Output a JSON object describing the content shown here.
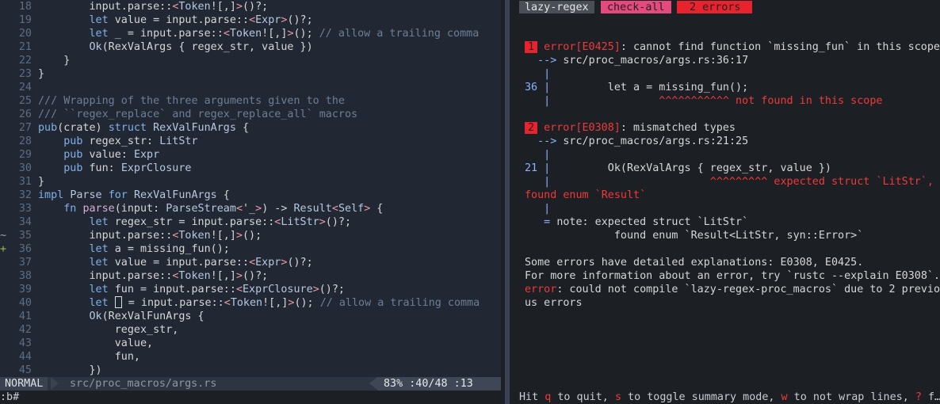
{
  "editor": {
    "lines": [
      {
        "n": "18",
        "sign": "",
        "parts": [
          [
            "",
            "        input.parse::"
          ],
          [
            "gn",
            "<"
          ],
          [
            "ty",
            "Token"
          ],
          [
            "",
            "![,]"
          ],
          [
            "gn",
            ">"
          ],
          [
            "",
            "()?;"
          ]
        ]
      },
      {
        "n": "19",
        "sign": "",
        "parts": [
          [
            "",
            "        "
          ],
          [
            "kw",
            "let"
          ],
          [
            "",
            " value = input.parse::"
          ],
          [
            "gn",
            "<"
          ],
          [
            "ty",
            "Expr"
          ],
          [
            "gn",
            ">"
          ],
          [
            "",
            "()?;"
          ]
        ]
      },
      {
        "n": "20",
        "sign": "",
        "parts": [
          [
            "",
            "        "
          ],
          [
            "kw",
            "let"
          ],
          [
            "",
            " _ = input.parse::"
          ],
          [
            "gn",
            "<"
          ],
          [
            "ty",
            "Token"
          ],
          [
            "",
            "![,]"
          ],
          [
            "gn",
            ">"
          ],
          [
            "",
            "(); "
          ],
          [
            "cm",
            "// allow a trailing comma"
          ]
        ]
      },
      {
        "n": "21",
        "sign": "",
        "parts": [
          [
            "",
            "        "
          ],
          [
            "ty",
            "Ok"
          ],
          [
            "",
            "(RexValArgs { regex_str, value })"
          ]
        ]
      },
      {
        "n": "22",
        "sign": "",
        "parts": [
          [
            "",
            "    }"
          ]
        ]
      },
      {
        "n": "23",
        "sign": "",
        "parts": [
          [
            "",
            "}"
          ]
        ]
      },
      {
        "n": "24",
        "sign": "",
        "parts": [
          [
            "",
            ""
          ]
        ]
      },
      {
        "n": "25",
        "sign": "",
        "parts": [
          [
            "cm",
            "/// Wrapping of the three arguments given to the"
          ]
        ]
      },
      {
        "n": "26",
        "sign": "",
        "parts": [
          [
            "cm",
            "/// ``regex_replace` and regex_replace_all` macros"
          ]
        ]
      },
      {
        "n": "27",
        "sign": "",
        "parts": [
          [
            "kw",
            "pub"
          ],
          [
            "",
            "(crate) "
          ],
          [
            "kw",
            "struct"
          ],
          [
            "",
            " "
          ],
          [
            "ty",
            "RexValFunArgs"
          ],
          [
            "",
            " {"
          ]
        ]
      },
      {
        "n": "28",
        "sign": "",
        "parts": [
          [
            "",
            "    "
          ],
          [
            "kw",
            "pub"
          ],
          [
            "",
            " regex_str: "
          ],
          [
            "ty",
            "LitStr"
          ],
          [
            ","
          ]
        ]
      },
      {
        "n": "29",
        "sign": "",
        "parts": [
          [
            "",
            "    "
          ],
          [
            "kw",
            "pub"
          ],
          [
            "",
            " value: "
          ],
          [
            "ty",
            "Expr"
          ],
          [
            ","
          ]
        ]
      },
      {
        "n": "30",
        "sign": "",
        "parts": [
          [
            "",
            "    "
          ],
          [
            "kw",
            "pub"
          ],
          [
            "",
            " fun: "
          ],
          [
            "ty",
            "ExprClosure"
          ],
          [
            ","
          ]
        ]
      },
      {
        "n": "31",
        "sign": "",
        "parts": [
          [
            "",
            "}"
          ]
        ]
      },
      {
        "n": "32",
        "sign": "",
        "parts": [
          [
            "kw",
            "impl"
          ],
          [
            "",
            " "
          ],
          [
            "ty",
            "Parse"
          ],
          [
            "",
            " "
          ],
          [
            "kw",
            "for"
          ],
          [
            "",
            " "
          ],
          [
            "ty",
            "RexValFunArgs"
          ],
          [
            "",
            " {"
          ]
        ]
      },
      {
        "n": "33",
        "sign": "",
        "parts": [
          [
            "",
            "    "
          ],
          [
            "kw",
            "fn"
          ],
          [
            "",
            " "
          ],
          [
            "fn",
            "parse"
          ],
          [
            "",
            "(input: "
          ],
          [
            "ty",
            "ParseStream"
          ],
          [
            "gn",
            "<"
          ],
          [
            "",
            "'_"
          ],
          [
            "gn",
            ">"
          ],
          [
            "",
            ") -> "
          ],
          [
            "ty",
            "Result"
          ],
          [
            "gn",
            "<"
          ],
          [
            "ty",
            "Self"
          ],
          [
            "gn",
            ">"
          ],
          [
            "",
            " {"
          ]
        ]
      },
      {
        "n": "34",
        "sign": "",
        "parts": [
          [
            "",
            "        "
          ],
          [
            "kw",
            "let"
          ],
          [
            "",
            " regex_str = input.parse::"
          ],
          [
            "gn",
            "<"
          ],
          [
            "ty",
            "LitStr"
          ],
          [
            "gn",
            ">"
          ],
          [
            "",
            "()?;"
          ]
        ]
      },
      {
        "n": "35",
        "sign": "~",
        "parts": [
          [
            "",
            "        input.parse::"
          ],
          [
            "gn",
            "<"
          ],
          [
            "ty",
            "Token"
          ],
          [
            "",
            "![,]"
          ],
          [
            "gn",
            ">"
          ],
          [
            "",
            "();"
          ]
        ]
      },
      {
        "n": "36",
        "sign": "+",
        "parts": [
          [
            "",
            "        "
          ],
          [
            "kw",
            "let"
          ],
          [
            "",
            " a = missing_fun();"
          ]
        ]
      },
      {
        "n": "37",
        "sign": "",
        "parts": [
          [
            "",
            "        "
          ],
          [
            "kw",
            "let"
          ],
          [
            "",
            " value = input.parse::"
          ],
          [
            "gn",
            "<"
          ],
          [
            "ty",
            "Expr"
          ],
          [
            "gn",
            ">"
          ],
          [
            "",
            "()?;"
          ]
        ]
      },
      {
        "n": "38",
        "sign": "",
        "parts": [
          [
            "",
            "        input.parse::"
          ],
          [
            "gn",
            "<"
          ],
          [
            "ty",
            "Token"
          ],
          [
            "",
            "![,]"
          ],
          [
            "gn",
            ">"
          ],
          [
            "",
            "()?;"
          ]
        ]
      },
      {
        "n": "39",
        "sign": "",
        "parts": [
          [
            "",
            "        "
          ],
          [
            "kw",
            "let"
          ],
          [
            "",
            " fun = input.parse::"
          ],
          [
            "gn",
            "<"
          ],
          [
            "ty",
            "ExprClosure"
          ],
          [
            "gn",
            ">"
          ],
          [
            "",
            "()?;"
          ]
        ]
      },
      {
        "n": "40",
        "sign": "",
        "parts": [
          [
            "",
            "        "
          ],
          [
            "kw",
            "let"
          ],
          [
            "",
            " "
          ],
          [
            "cursor",
            "_"
          ],
          [
            "",
            " = input.parse::"
          ],
          [
            "gn",
            "<"
          ],
          [
            "ty",
            "Token"
          ],
          [
            "",
            "![,]"
          ],
          [
            "gn",
            ">"
          ],
          [
            "",
            "(); "
          ],
          [
            "cm",
            "// allow a trailing comma"
          ]
        ]
      },
      {
        "n": "41",
        "sign": "",
        "parts": [
          [
            "",
            "        "
          ],
          [
            "ty",
            "Ok"
          ],
          [
            "",
            "(RexValFunArgs {"
          ]
        ]
      },
      {
        "n": "42",
        "sign": "",
        "parts": [
          [
            "",
            "            regex_str,"
          ]
        ]
      },
      {
        "n": "43",
        "sign": "",
        "parts": [
          [
            "",
            "            value,"
          ]
        ]
      },
      {
        "n": "44",
        "sign": "",
        "parts": [
          [
            "",
            "            fun,"
          ]
        ]
      },
      {
        "n": "45",
        "sign": "",
        "parts": [
          [
            "",
            "        })"
          ]
        ]
      }
    ],
    "status": {
      "mode": "NORMAL",
      "file": "src/proc_macros/args.rs",
      "position": "83%  :40/48  :13"
    },
    "cmdline": ":b#"
  },
  "bacon": {
    "project": "lazy-regex",
    "job": "check-all",
    "errors_badge": "2 errors",
    "lines": [
      [],
      [
        [
          "redbox",
          "1"
        ],
        [
          "red",
          " error[E0425]"
        ],
        [
          "",
          ": cannot find function `missing_fun` in this scope"
        ]
      ],
      [
        [
          "blue",
          "  --> "
        ],
        [
          "",
          "src/proc_macros/args.rs:36:17"
        ]
      ],
      [
        [
          "blue",
          "   |"
        ]
      ],
      [
        [
          "blue",
          "36 |"
        ],
        [
          "",
          "         let a = missing_fun();"
        ]
      ],
      [
        [
          "blue",
          "   |"
        ],
        [
          "red",
          "                 ^^^^^^^^^^^ not found in this scope"
        ]
      ],
      [],
      [
        [
          "redbox",
          "2"
        ],
        [
          "red",
          " error[E0308]"
        ],
        [
          "",
          ": mismatched types"
        ]
      ],
      [
        [
          "blue",
          "  --> "
        ],
        [
          "",
          "src/proc_macros/args.rs:21:25"
        ]
      ],
      [
        [
          "blue",
          "   |"
        ]
      ],
      [
        [
          "blue",
          "21 |"
        ],
        [
          "",
          "         Ok(RexValArgs { regex_str, value })"
        ]
      ],
      [
        [
          "blue",
          "   |"
        ],
        [
          "red",
          "                         ^^^^^^^^^ expected struct `LitStr`,"
        ]
      ],
      [
        [
          "red",
          "found enum `Result`"
        ]
      ],
      [
        [
          "blue",
          "   |"
        ]
      ],
      [
        [
          "blue",
          "   = "
        ],
        [
          "",
          "note: expected struct `LitStr`"
        ]
      ],
      [
        [
          "",
          "              found enum `Result<LitStr, syn::Error>`"
        ]
      ],
      [],
      [
        [
          "",
          "Some errors have detailed explanations: E0308, E0425."
        ]
      ],
      [
        [
          "",
          "For more information about an error, try `rustc --explain E0308`."
        ]
      ],
      [
        [
          "red",
          "error"
        ],
        [
          "",
          ": could not compile `lazy-regex-proc_macros` due to 2 previo"
        ]
      ],
      [
        [
          "",
          "us errors"
        ]
      ]
    ],
    "hint": [
      [
        "",
        "Hit "
      ],
      [
        "key",
        "q"
      ],
      [
        "",
        " to quit, "
      ],
      [
        "key",
        "s"
      ],
      [
        "",
        " to toggle summary mode, "
      ],
      [
        "key",
        "w"
      ],
      [
        "",
        " to not wrap lines, "
      ],
      [
        "key",
        "?"
      ],
      [
        "",
        " f…"
      ]
    ]
  },
  "colors": {
    "accent_pink": "#e64a7c",
    "error_red": "#e8232e",
    "editor_bg": "#212833"
  }
}
